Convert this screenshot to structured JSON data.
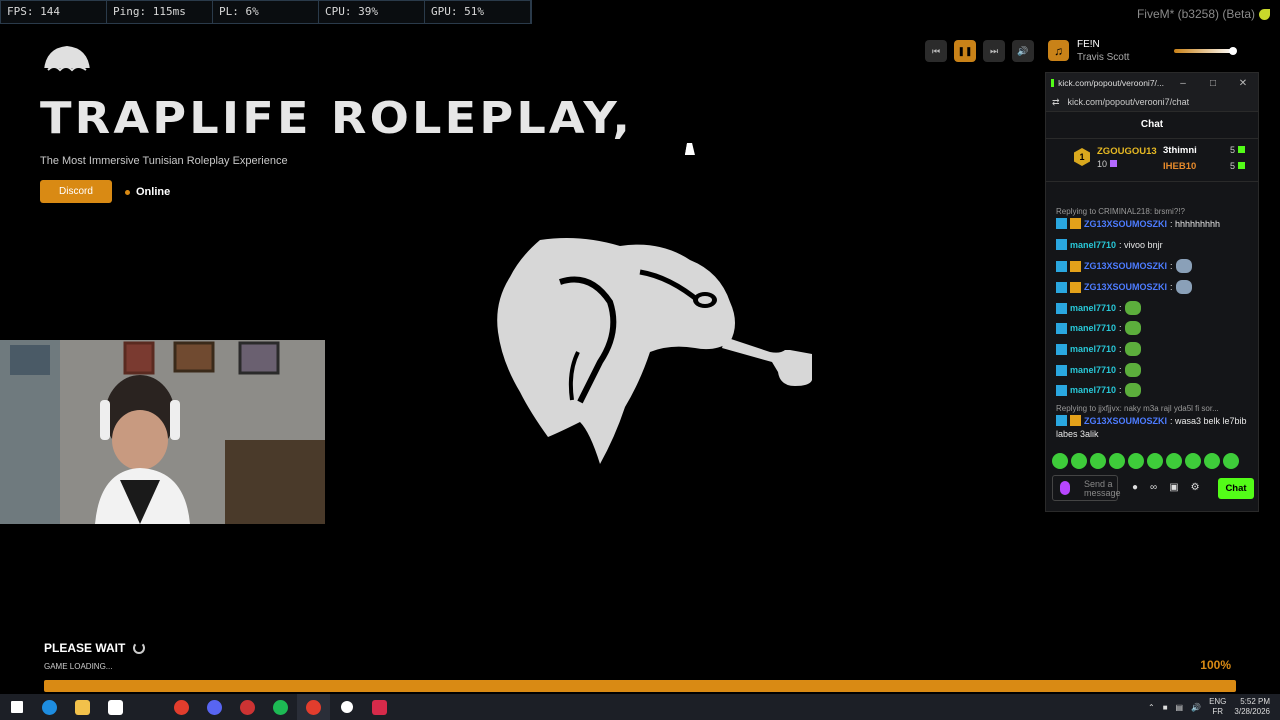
{
  "stats": [
    {
      "label": "FPS: 144"
    },
    {
      "label": "Ping: 115ms"
    },
    {
      "label": "PL: 6%"
    },
    {
      "label": "CPU: 39%"
    },
    {
      "label": "GPU: 51%"
    }
  ],
  "fivem_version": "FiveM* (b3258) (Beta)",
  "server": {
    "title": "TRAPLIFE ROLEPLAY,",
    "subtitle": "The Most Immersive Tunisian Roleplay Experience",
    "discord_label": "Discord",
    "status": "Online"
  },
  "media": {
    "song_title": "FE!N",
    "artist": "Travis Scott",
    "volume": 0.9,
    "accent": "#c98218"
  },
  "chat": {
    "window_title": "kick.com/popout/verooni7/...",
    "url": "kick.com/popout/verooni7/chat",
    "header": "Chat",
    "leaderboard": [
      {
        "rank": "1",
        "name": "ZGOUGOU13",
        "count": "10"
      },
      {
        "name": "3thimni",
        "count": "5"
      },
      {
        "name": "IHEB10",
        "count": "5"
      }
    ],
    "reply1": "Replying to CRIMINAL218: brsmi?!?",
    "messages": [
      {
        "user": "ZG13XSOUMOSZKI",
        "text": ": hhhhhhhhh"
      },
      {
        "user": "manel7710",
        "text": ": vivoo bnjr"
      },
      {
        "user": "ZG13XSOUMOSZKI",
        "text": ":"
      },
      {
        "user": "ZG13XSOUMOSZKI",
        "text": ":"
      },
      {
        "user": "manel7710",
        "text": ":"
      },
      {
        "user": "manel7710",
        "text": ":"
      },
      {
        "user": "manel7710",
        "text": ":"
      },
      {
        "user": "manel7710",
        "text": ":"
      },
      {
        "user": "manel7710",
        "text": ":"
      }
    ],
    "reply2": "Replying to jjxfjjvx: naky m3a rajl yda5l fi sor...",
    "last_user": "ZG13XSOUMOSZKI",
    "last_text": ": wasa3 belk le7bib",
    "last_text2": "labes 3alik",
    "input_placeholder": "Send a message",
    "send_label": "Chat",
    "brand_color": "#53fc18"
  },
  "loading": {
    "wait_label": "PLEASE WAIT",
    "status": "GAME LOADING...",
    "percent_label": "100%",
    "progress": 1.0
  },
  "taskbar": {
    "lang1": "ENG",
    "lang2": "FR",
    "time": "5:52 PM",
    "date": "3/28/2026"
  }
}
